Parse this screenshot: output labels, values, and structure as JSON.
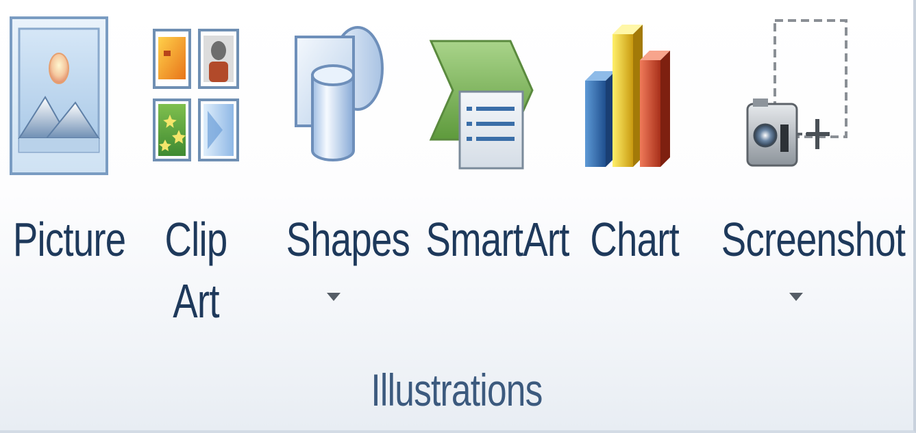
{
  "group": {
    "label": "Illustrations"
  },
  "commands": {
    "picture": {
      "label": "Picture",
      "icon": "picture-icon"
    },
    "clip_art": {
      "label_line1": "Clip",
      "label_line2": "Art",
      "icon": "clip-art-icon"
    },
    "shapes": {
      "label": "Shapes",
      "icon": "shapes-icon",
      "has_dropdown": true
    },
    "smartart": {
      "label": "SmartArt",
      "icon": "smartart-icon"
    },
    "chart": {
      "label": "Chart",
      "icon": "chart-icon"
    },
    "screenshot": {
      "label": "Screenshot",
      "icon": "screenshot-icon",
      "has_dropdown": true
    }
  },
  "colors": {
    "label_text": "#1e395b",
    "group_label_text": "#3c5a7e",
    "chart_blue": "#2f6fb5",
    "chart_yellow": "#e8c21a",
    "chart_red": "#d9442a",
    "smartart_green": "#7eb45a"
  }
}
